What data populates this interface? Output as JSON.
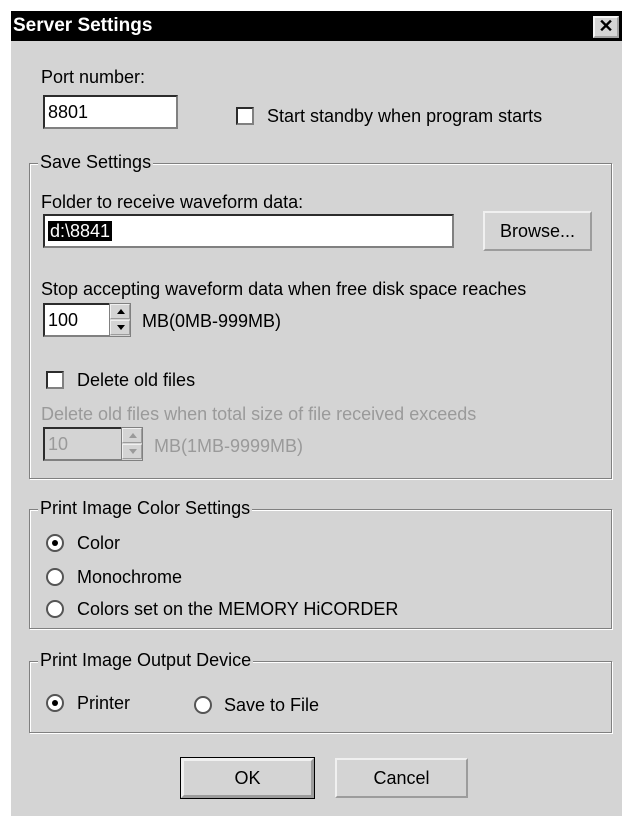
{
  "title": "Server Settings",
  "close_glyph": "✕",
  "port": {
    "label": "Port number:",
    "value": "8801",
    "standby_label": "Start standby when program starts",
    "standby_checked": false
  },
  "save_settings": {
    "legend": "Save Settings",
    "folder_label": "Folder to receive waveform data:",
    "folder_value": "d:\\8841",
    "browse_label": "Browse...",
    "stop_label": "Stop accepting waveform data when free disk space reaches",
    "stop_value": "100",
    "stop_unit": "MB(0MB-999MB)",
    "delete_label": "Delete old files",
    "delete_checked": false,
    "delete_exceed_label": "Delete old files when total size of file received exceeds",
    "delete_exceed_value": "10",
    "delete_exceed_unit": "MB(1MB-9999MB)"
  },
  "print_color": {
    "legend": "Print Image Color Settings",
    "options": [
      "Color",
      "Monochrome",
      "Colors set on the MEMORY HiCORDER"
    ],
    "selected": "Color"
  },
  "print_output": {
    "legend": "Print Image Output Device",
    "options": [
      "Printer",
      "Save to File"
    ],
    "selected": "Printer"
  },
  "buttons": {
    "ok": "OK",
    "cancel": "Cancel"
  }
}
